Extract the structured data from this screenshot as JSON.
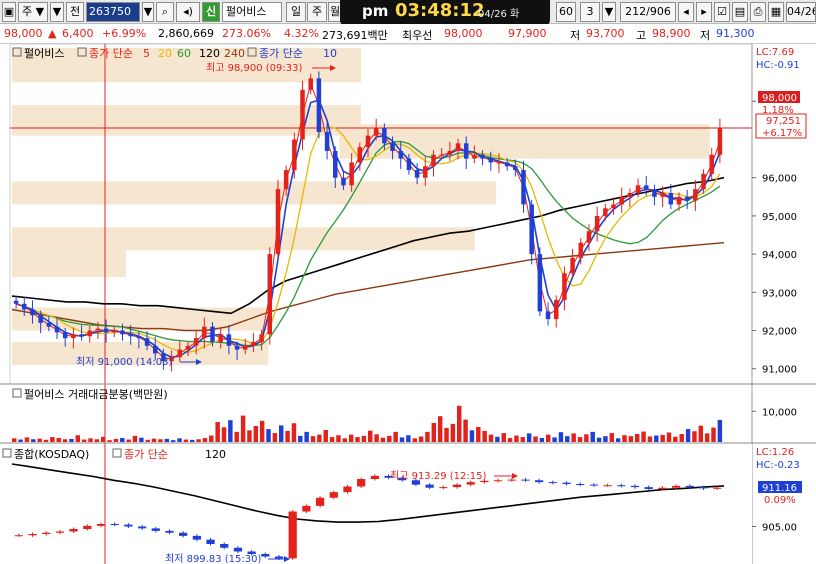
{
  "toolbar": {
    "market_label": "주",
    "dropdown_arrow": "▼",
    "all_label": "전",
    "search_icon": "search-icon",
    "stock_code": "263750",
    "new_badge": "신",
    "stock_name": "펄어비스",
    "period_day": "일",
    "period_week": "주",
    "period_month": "월",
    "interval_value": "60",
    "count_value": "3",
    "page_counter": "212/906",
    "date_right": "04/26",
    "clock": {
      "ampm": "pm",
      "time": "03:48:12",
      "date": "04/26 화"
    }
  },
  "quote": {
    "price": "98,000",
    "change": "6,400",
    "change_rate": "+6.99%",
    "volume": "2,860,669",
    "volume_rate": "273.06%",
    "turnover_rate": "4.32%",
    "amount": "273,691백만",
    "best_label": "최우선",
    "best_ask": "98,000",
    "best_bid": "97,900",
    "low_label": "저",
    "low_value": "93,700",
    "high_label": "고",
    "high_value": "98,900",
    "prev_low_label": "저",
    "prev_low_value": "91,300"
  },
  "chart_data": [
    {
      "type": "line",
      "panel": "price",
      "legend": {
        "stock_name": "펄어비스",
        "ma_title": "종가 단순",
        "ma_periods": [
          "5",
          "20",
          "60",
          "120",
          "240"
        ],
        "ma_colors": [
          "#e4221c",
          "#e8b800",
          "#2a9a3a",
          "#000000",
          "#8b3a12"
        ],
        "ma_title2": "종가 단순",
        "ma_period2": "10"
      },
      "x_range": [
        "04/25 09:00",
        "04/26 15:30"
      ],
      "y_range": [
        90600,
        99500
      ],
      "y_ticks": [
        "98,000",
        "96,000",
        "95,000",
        "94,000",
        "93,000",
        "92,000",
        "91,000"
      ],
      "y_tick_values": [
        98000,
        96000,
        95000,
        94000,
        93000,
        92000,
        91000
      ],
      "corner_labels": {
        "lc": "LC:7.69",
        "hc": "HC:-0.91"
      },
      "current_price_box": {
        "value": "97,251",
        "rate": "+6.17%"
      },
      "limit_box": "98,000",
      "limit_pct": "1.18%",
      "annotations": {
        "high": "최고 98,900 (09:33)",
        "low": "최저 91,000 (14:03)"
      },
      "close_series": [
        92.7,
        92.55,
        92.4,
        92.2,
        92.1,
        91.95,
        91.8,
        91.9,
        91.85,
        92.0,
        92.05,
        91.95,
        92.0,
        91.9,
        91.85,
        91.8,
        91.6,
        91.4,
        91.2,
        91.3,
        91.5,
        91.6,
        91.8,
        92.1,
        91.7,
        91.9,
        91.6,
        91.5,
        91.6,
        91.7,
        91.9,
        94.0,
        95.7,
        96.2,
        97.0,
        98.3,
        98.6,
        97.2,
        96.7,
        96.0,
        95.8,
        96.4,
        96.8,
        97.1,
        97.3,
        96.9,
        96.7,
        96.5,
        96.2,
        96.0,
        96.3,
        96.6,
        96.6,
        96.7,
        96.9,
        96.5,
        96.6,
        96.5,
        96.4,
        96.4,
        96.3,
        96.2,
        95.3,
        94.0,
        92.5,
        92.3,
        92.8,
        93.5,
        93.9,
        94.3,
        94.6,
        95.0,
        95.2,
        95.3,
        95.5,
        95.6,
        95.8,
        95.7,
        95.5,
        95.6,
        95.3,
        95.5,
        95.4,
        95.7,
        96.1,
        96.6,
        97.3
      ],
      "ma_series": {
        "black": [
          92.9,
          92.85,
          92.8,
          92.75,
          92.75,
          92.7,
          92.7,
          92.65,
          92.65,
          92.6,
          92.55,
          92.5,
          92.45,
          92.7,
          93.05,
          93.3,
          93.45,
          93.6,
          93.75,
          93.9,
          94.05,
          94.2,
          94.35,
          94.45,
          94.55,
          94.6,
          94.7,
          94.8,
          94.9,
          95.0,
          95.15,
          95.25,
          95.35,
          95.45,
          95.55,
          95.65,
          95.75,
          95.85,
          95.9,
          96.0
        ],
        "brown": [
          92.55,
          92.45,
          92.35,
          92.25,
          92.15,
          92.1,
          92.05,
          92.05,
          92.0,
          92.0,
          92.1,
          92.3,
          92.5,
          92.65,
          92.8,
          92.95,
          93.05,
          93.15,
          93.25,
          93.35,
          93.45,
          93.55,
          93.65,
          93.75,
          93.85,
          93.9,
          93.95,
          94.0,
          94.05,
          94.1,
          94.15,
          94.2,
          94.25,
          94.3
        ]
      },
      "highlight_bands": [
        [
          98.5,
          99.4,
          0.0,
          0.49
        ],
        [
          97.1,
          97.9,
          0.0,
          0.49
        ],
        [
          95.3,
          95.9,
          0.0,
          0.68
        ],
        [
          94.1,
          94.7,
          0.0,
          0.65
        ],
        [
          93.4,
          94.1,
          0.0,
          0.16
        ],
        [
          92.0,
          92.6,
          0.0,
          0.36
        ],
        [
          91.1,
          91.7,
          0.0,
          0.36
        ],
        [
          96.5,
          97.4,
          0.46,
          0.98
        ],
        [
          96.5,
          97.0,
          0.72,
          0.88
        ]
      ]
    },
    {
      "type": "bar",
      "panel": "volume",
      "title": "펄어비스 거래대금분봉(백만원)",
      "y_tick": "10,000",
      "y_tick_value": 10000,
      "y_range": [
        0,
        14000
      ],
      "values": [
        1200,
        800,
        1500,
        900,
        1100,
        700,
        1600,
        1300,
        900,
        1000,
        2200,
        800,
        1200,
        900,
        1700,
        600,
        1000,
        1300,
        800,
        2000,
        1400,
        700,
        1100,
        900,
        1000,
        600,
        1200,
        800,
        700,
        900,
        1300,
        2100,
        6500,
        4800,
        7100,
        3300,
        8600,
        3800,
        5200,
        6900,
        4200,
        2900,
        5400,
        3600,
        6100,
        2000,
        3300,
        1900,
        2400,
        3900,
        1600,
        2200,
        1200,
        2400,
        1600,
        2000,
        3700,
        2500,
        1400,
        2000,
        3300,
        1500,
        2200,
        1200,
        1800,
        3300,
        6200,
        8400,
        4600,
        5900,
        11800,
        7300,
        3800,
        4900,
        3600,
        2400,
        1700,
        2900,
        1300,
        2100,
        1600,
        2800,
        1800,
        1300,
        2400,
        1500,
        3200,
        1900,
        2800,
        1600,
        2500,
        3300,
        1400,
        1900,
        2900,
        1200,
        2200,
        1900,
        2600,
        3400,
        1800,
        2100,
        2300,
        3100,
        1700,
        2600,
        4200,
        3500,
        5300,
        2800,
        4700,
        7200
      ],
      "value_colors_rule": "red if close up, blue if close down"
    },
    {
      "type": "line",
      "panel": "kosdaq",
      "legend": {
        "index_name": "종합(KOSDAQ)",
        "ma_title": "종가 단순",
        "ma_period": "120"
      },
      "corner_labels": {
        "lc": "LC:1.26",
        "hc": "HC:-0.23"
      },
      "y_range": [
        899.0,
        915.0
      ],
      "y_ticks": [
        "905.00"
      ],
      "y_tick_values": [
        905.0
      ],
      "current_box": {
        "value": "911.16",
        "rate": "0.09%"
      },
      "annotations": {
        "high": "최고 913.29 (12:15)",
        "low": "최저 899.83 (15:30)"
      },
      "close_series": [
        903.6,
        903.8,
        904.0,
        904.2,
        904.6,
        905.1,
        905.4,
        905.3,
        905.0,
        904.7,
        904.3,
        904.0,
        903.5,
        902.9,
        902.2,
        901.6,
        901.0,
        900.6,
        900.2,
        899.9,
        907.4,
        908.3,
        909.6,
        910.5,
        911.4,
        912.6,
        913.1,
        912.8,
        912.4,
        911.7,
        911.2,
        911.3,
        911.7,
        912.1,
        912.3,
        912.4,
        912.5,
        912.4,
        912.1,
        912.0,
        911.8,
        911.7,
        911.6,
        911.6,
        911.5,
        911.3,
        911.0,
        911.2,
        911.5,
        911.3,
        911.1,
        911.2
      ],
      "ma_series": [
        915.0,
        914.5,
        914.0,
        913.5,
        913.0,
        912.4,
        911.9,
        911.3,
        910.6,
        909.9,
        909.1,
        908.3,
        907.5,
        906.8,
        906.2,
        905.9,
        905.7,
        905.7,
        905.8,
        906.1,
        906.5,
        906.9,
        907.3,
        907.7,
        908.1,
        908.5,
        908.9,
        909.3,
        909.7,
        910.0,
        910.3,
        910.6,
        910.9,
        911.1,
        911.3,
        911.5
      ]
    }
  ],
  "colors": {
    "up": "#e4221c",
    "down": "#1f3fd6",
    "band": "#f6e5cf",
    "limit": "#d91f1f"
  }
}
